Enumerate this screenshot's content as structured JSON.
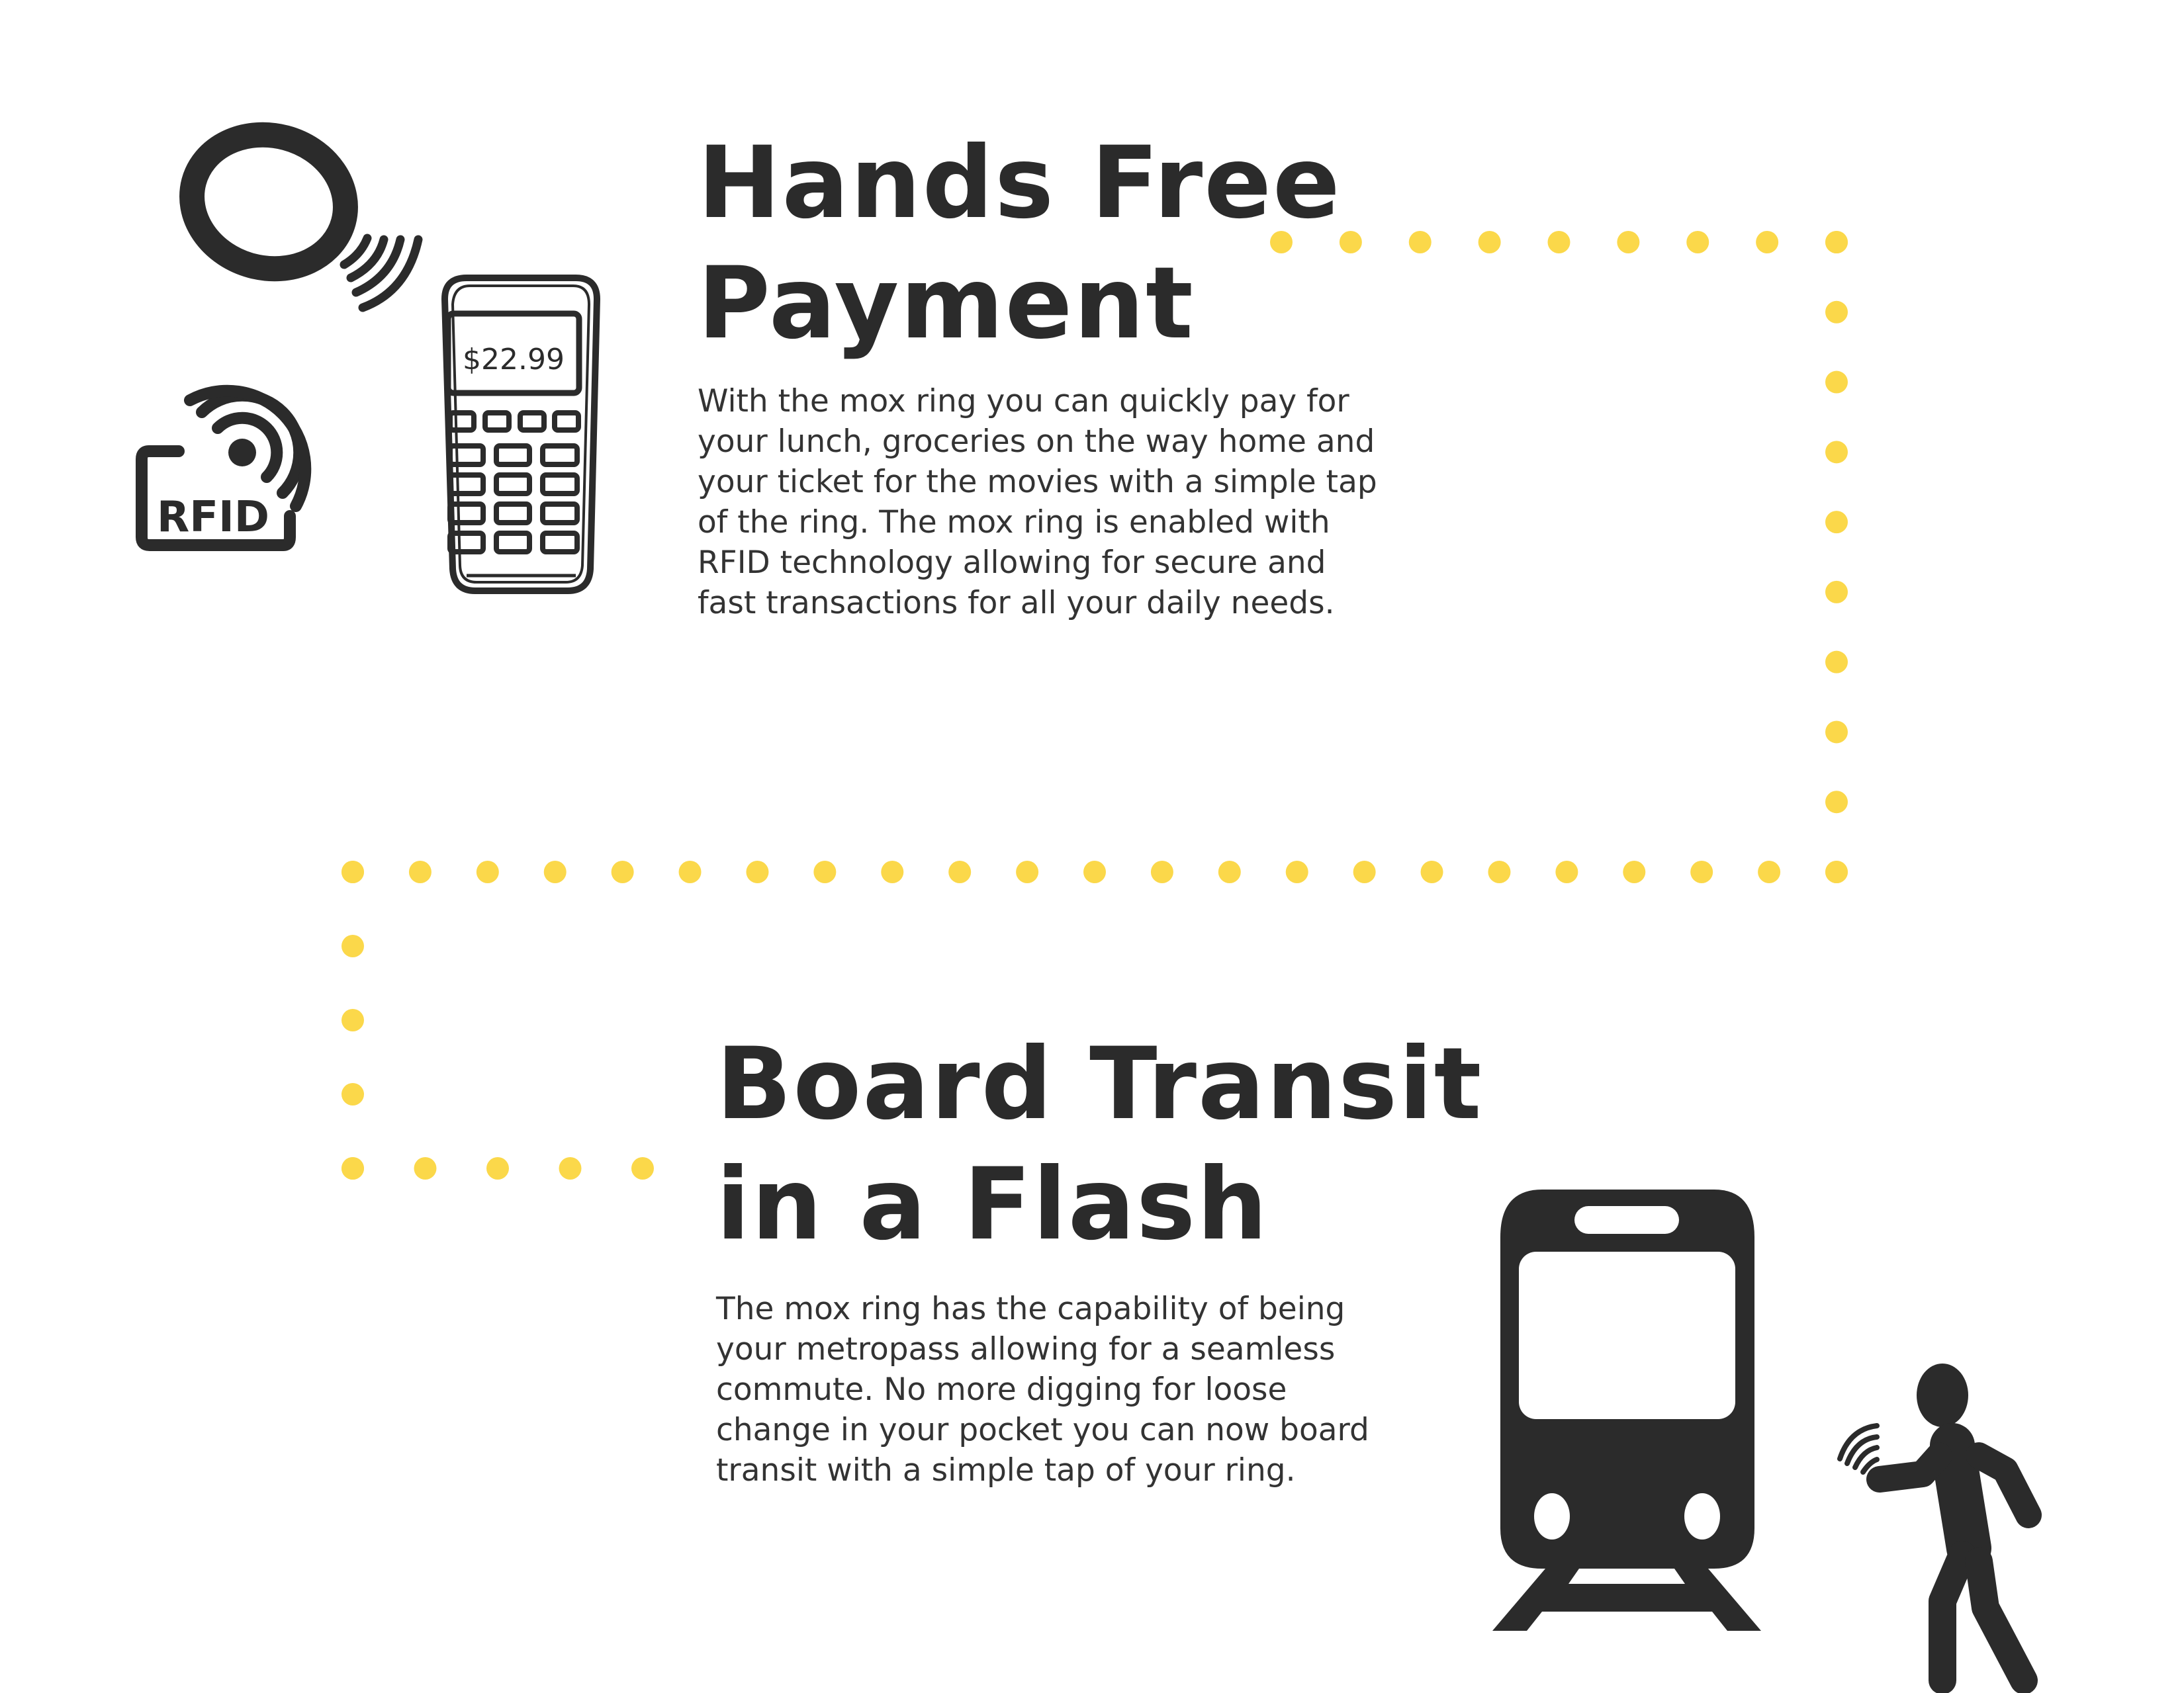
{
  "colors": {
    "accent": "#FBD84A",
    "ink": "#2b2b2b"
  },
  "payment": {
    "title_lines": [
      "Hands Free",
      "Payment"
    ],
    "body_lines": [
      "With the mox ring you can quickly pay for",
      "your lunch, groceries on the way home and",
      "your ticket for the movies with a simple tap",
      "of the ring. The mox ring is enabled with",
      "RFID technology allowing for secure and",
      "fast transactions for all your daily needs."
    ],
    "terminal_amount": "$22.99",
    "rfid_label": "RFID"
  },
  "transit": {
    "title_lines": [
      "Board Transit",
      "in a Flash"
    ],
    "body_lines": [
      "The mox ring has the capability of being",
      "your metropass allowing for a seamless",
      "commute. No more digging for loose",
      "change in your pocket you can now board",
      "transit with a simple tap of your ring."
    ]
  }
}
